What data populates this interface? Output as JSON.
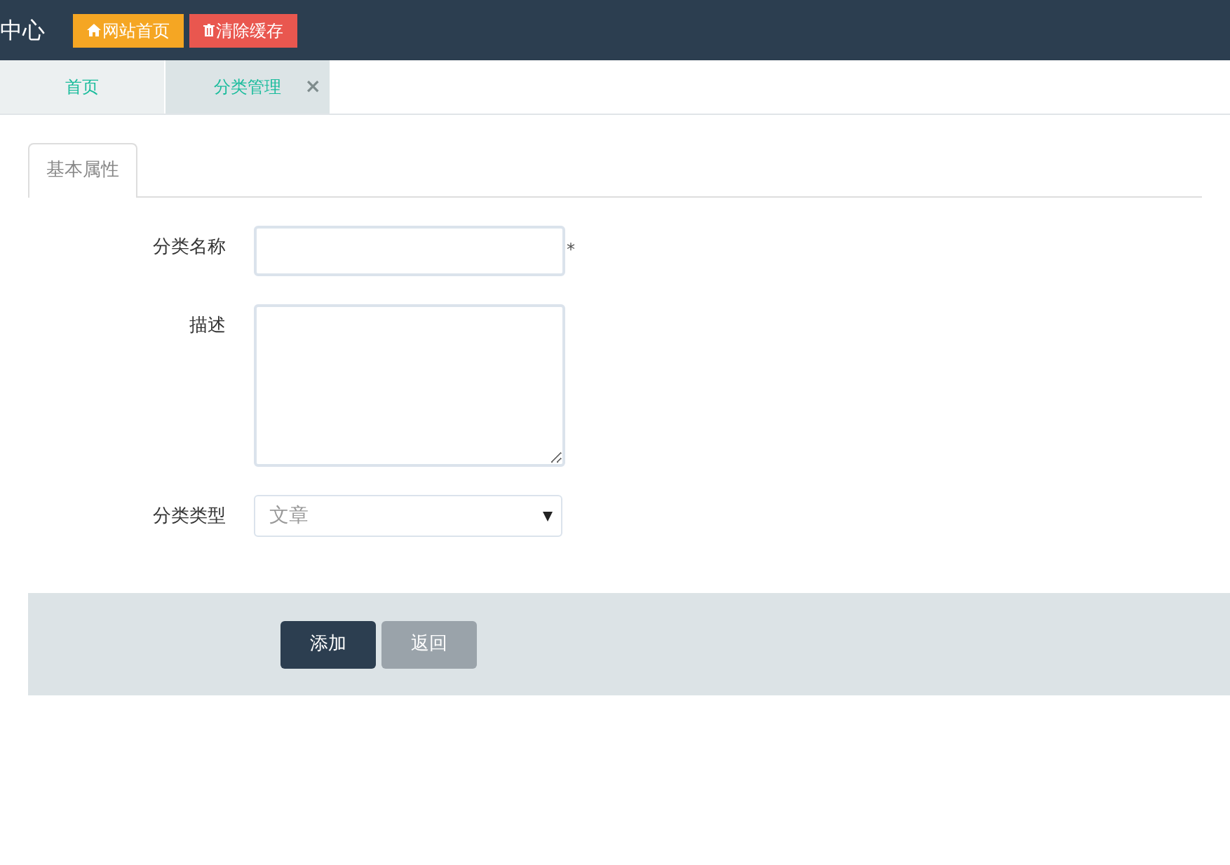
{
  "header": {
    "title": "中心",
    "buttons": [
      {
        "kind": "home",
        "label": "网站首页"
      },
      {
        "kind": "clear",
        "label": "清除缓存"
      }
    ]
  },
  "tabs": [
    {
      "label": "首页",
      "selected": false
    },
    {
      "label": "分类管理",
      "selected": true,
      "close": "×"
    }
  ],
  "form_tabs": [
    {
      "label": "基本属性",
      "selected": true
    }
  ],
  "form": {
    "fields": [
      {
        "kind": "text",
        "label": "分类名称",
        "required_mark": "*"
      },
      {
        "kind": "textarea",
        "label": "描述"
      },
      {
        "kind": "select",
        "label": "分类类型",
        "value": "文章"
      }
    ]
  },
  "actions": [
    {
      "kind": "primary",
      "label": "添加"
    },
    {
      "kind": "secondary",
      "label": "返回"
    }
  ]
}
